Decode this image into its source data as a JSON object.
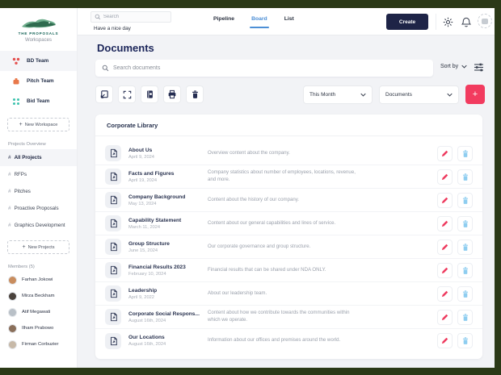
{
  "brand": {
    "name": "THE PROPOSALS",
    "tagline": "Workspaces",
    "logo": "crocodile-logo"
  },
  "topbar": {
    "search_placeholder": "Search",
    "greeting": "Have a nice day",
    "tabs": [
      {
        "label": "Pipeline"
      },
      {
        "label": "Board"
      },
      {
        "label": "List"
      }
    ],
    "active_tab": "Board",
    "create_label": "Create",
    "icons": [
      "gear-icon",
      "bell-icon",
      "avatar"
    ]
  },
  "sidebar": {
    "teams": [
      {
        "label": "BD Team",
        "color": "#e4504e",
        "active": true
      },
      {
        "label": "Pitch Team",
        "color": "#e8784a",
        "active": false
      },
      {
        "label": "Bid Team",
        "color": "#3ec3ae",
        "active": false
      }
    ],
    "new_workspace_label": "New Workspace",
    "projects_header": "Projects Overview",
    "projects": [
      {
        "label": "All Projects",
        "active": true
      },
      {
        "label": "RFPs",
        "active": false
      },
      {
        "label": "Pitches",
        "active": false
      },
      {
        "label": "Proactive Proposals",
        "active": false
      },
      {
        "label": "Graphics Development",
        "active": false
      }
    ],
    "new_project_label": "New Projects",
    "members_header": "Members (5)",
    "members": [
      {
        "name": "Farhan Jokowi",
        "color": "#c98d5e"
      },
      {
        "name": "Mirza Beckham",
        "color": "#4a423c"
      },
      {
        "name": "Atif Megawati",
        "color": "#b9c0c7"
      },
      {
        "name": "Ilham Prabowo",
        "color": "#8a6f5a"
      },
      {
        "name": "Firman Corbuzier",
        "color": "#c7b9a8"
      }
    ]
  },
  "main": {
    "title": "Documents",
    "search_placeholder": "Search documents",
    "sort_label": "Sort by",
    "toolbar_icons": [
      "export-icon",
      "expand-icon",
      "book-icon",
      "printer-icon",
      "trash-icon"
    ],
    "period_filter": "This Month",
    "type_filter": "Documents",
    "section_title": "Corporate Library",
    "documents": [
      {
        "title": "About Us",
        "date": "April 9, 2024",
        "desc": "Overview content about the company."
      },
      {
        "title": "Facts and Figures",
        "date": "April 19, 2024",
        "desc": "Company statistics about number of employees, locations, revenue, and more."
      },
      {
        "title": "Company Background",
        "date": "May 13, 2024",
        "desc": "Content about the history of our company."
      },
      {
        "title": "Capability Statement",
        "date": "March 11, 2024",
        "desc": "Content about our general capabilities and lines of service."
      },
      {
        "title": "Group Structure",
        "date": "June 15, 2024",
        "desc": "Our corporate governance and group structure."
      },
      {
        "title": "Financial Results 2023",
        "date": "February 10, 2024",
        "desc": "Financial results that can be shared under NDA ONLY."
      },
      {
        "title": "Leadership",
        "date": "April 9, 2022",
        "desc": "About our leadership team."
      },
      {
        "title": "Corporate Social Respons...",
        "date": "August 16th, 2024",
        "desc": "Content about how we contribute towards the communities within which we operate."
      },
      {
        "title": "Our Locations",
        "date": "August 16th, 2024",
        "desc": "Information about our offices and premises around the world."
      }
    ]
  },
  "colors": {
    "frame": "#2b3917",
    "accent_pink": "#f23b5f",
    "navy": "#1b2559",
    "active_tab_blue": "#4d8fd6",
    "pencil_red": "#ee3a5e",
    "trash_blue": "#8ecdf0"
  }
}
